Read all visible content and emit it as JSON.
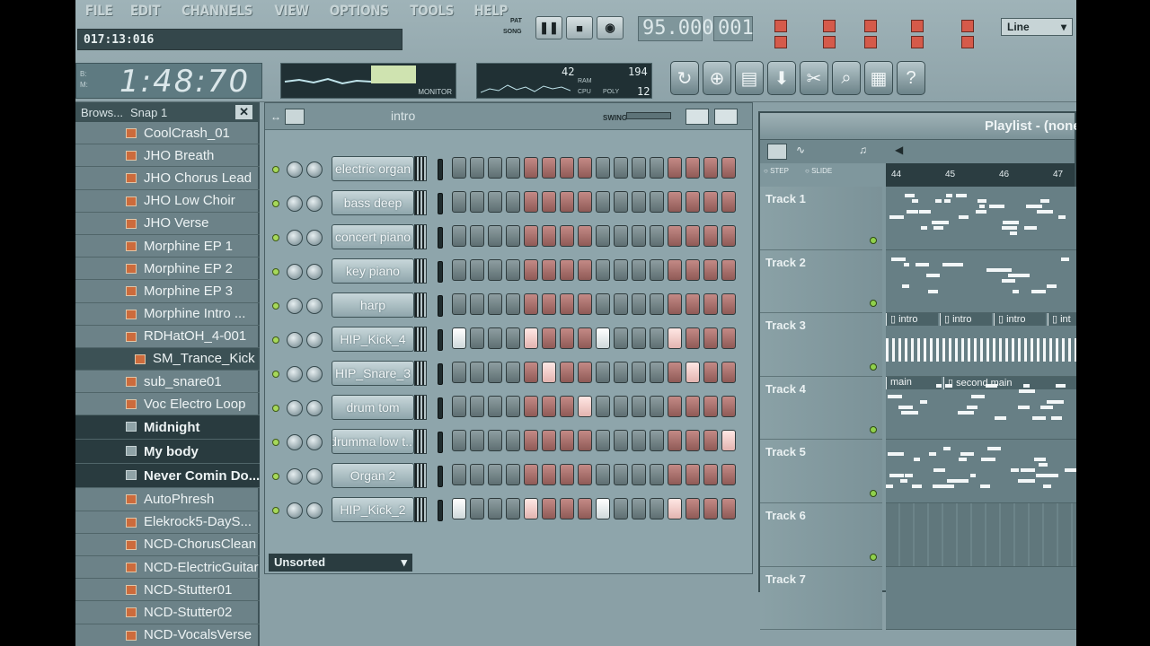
{
  "menu": [
    "FILE",
    "EDIT",
    "CHANNELS",
    "VIEW",
    "OPTIONS",
    "TOOLS",
    "HELP"
  ],
  "hint": "017:13:016",
  "clock": {
    "time": "1:48:70",
    "labels": [
      "B:",
      "M:"
    ]
  },
  "transport": {
    "pat_label": "PAT",
    "song_label": "SONG",
    "tempo": "95.000",
    "pattern_num": "001",
    "play": "pause-icon",
    "stop": "stop-icon",
    "record": "record-icon"
  },
  "monitor_label": "MONITOR",
  "cpu": {
    "value1": "42",
    "value2": "194",
    "ram_label": "RAM",
    "cpu_label": "CPU",
    "poly_label": "POLY",
    "poly": "12"
  },
  "snap_mode": "Line",
  "browser": {
    "title": "Brows...",
    "snap": "Snap 1",
    "items": [
      {
        "label": "CoolCrash_01",
        "type": "file"
      },
      {
        "label": "JHO Breath",
        "type": "file"
      },
      {
        "label": "JHO Chorus Lead",
        "type": "file"
      },
      {
        "label": "JHO Low Choir",
        "type": "file"
      },
      {
        "label": "JHO Verse",
        "type": "file"
      },
      {
        "label": "Morphine EP 1",
        "type": "file"
      },
      {
        "label": "Morphine EP 2",
        "type": "file"
      },
      {
        "label": "Morphine EP 3",
        "type": "file"
      },
      {
        "label": "Morphine Intro ...",
        "type": "file"
      },
      {
        "label": "RDHatOH_4-001",
        "type": "file"
      },
      {
        "label": "SM_Trance_Kick",
        "type": "selected"
      },
      {
        "label": "sub_snare01",
        "type": "file"
      },
      {
        "label": "Voc Electro Loop",
        "type": "file"
      },
      {
        "label": "Midnight",
        "type": "folder"
      },
      {
        "label": "My body",
        "type": "folder"
      },
      {
        "label": "Never Comin Do...",
        "type": "folder"
      },
      {
        "label": "AutoPhresh",
        "type": "file"
      },
      {
        "label": "Elekrock5-DayS...",
        "type": "file"
      },
      {
        "label": "NCD-ChorusClean",
        "type": "file"
      },
      {
        "label": "NCD-ElectricGuitar",
        "type": "file"
      },
      {
        "label": "NCD-Stutter01",
        "type": "file"
      },
      {
        "label": "NCD-Stutter02",
        "type": "file"
      },
      {
        "label": "NCD-VocalsVerse",
        "type": "file"
      }
    ]
  },
  "sequencer": {
    "pattern": "intro",
    "swing_label": "SWING",
    "group": "Unsorted",
    "channels": [
      {
        "name": "electric organ",
        "steps": []
      },
      {
        "name": "bass deep",
        "steps": []
      },
      {
        "name": "concert piano",
        "steps": []
      },
      {
        "name": "key piano",
        "steps": []
      },
      {
        "name": "harp",
        "steps": []
      },
      {
        "name": "HIP_Kick_4",
        "steps": [
          0,
          4,
          8,
          12
        ]
      },
      {
        "name": "HIP_Snare_3",
        "steps": [
          5,
          13
        ]
      },
      {
        "name": "drum tom",
        "steps": [
          7
        ]
      },
      {
        "name": "drumma low t...",
        "steps": [
          15
        ]
      },
      {
        "name": "Organ 2",
        "steps": []
      },
      {
        "name": "HIP_Kick_2",
        "steps": [
          0,
          4,
          8,
          12
        ]
      }
    ]
  },
  "playlist": {
    "title": "Playlist - (none",
    "step_label": "STEP",
    "slide_label": "SLIDE",
    "ruler": [
      "44",
      "45",
      "46",
      "47"
    ],
    "tracks": [
      "Track 1",
      "Track 2",
      "Track 3",
      "Track 4",
      "Track 5",
      "Track 6",
      "Track 7"
    ],
    "track3_patterns": [
      "intro",
      "intro",
      "intro",
      "int"
    ],
    "track4_patterns": [
      "main",
      "second main"
    ]
  }
}
